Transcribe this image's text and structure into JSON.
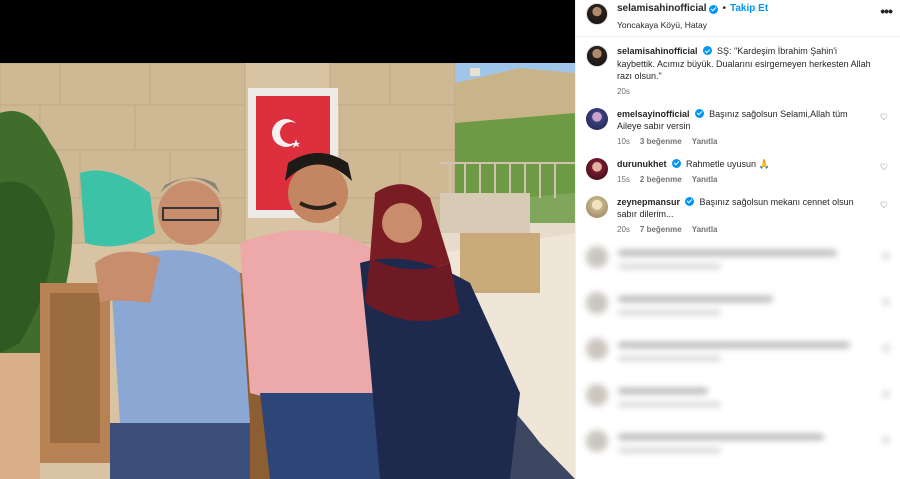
{
  "post": {
    "username": "selamisahinofficial",
    "dot": "•",
    "follow_label": "Takip Et",
    "location": "Yoncakaya Köyü, Hatay",
    "more_label": "•••"
  },
  "caption": {
    "username": "selamisahinofficial",
    "text": "SŞ: \"Kardeşim İbrahim Şahin'i kaybettik. Acımız büyük. Dualarını esirgemeyen herkesten Allah razı olsun.\"",
    "time": "20s"
  },
  "comments": [
    {
      "username": "emelsayinofficial",
      "text": "Başınız sağolsun Selami,Allah tüm Aileye sabır versin",
      "time": "10s",
      "likes": "3 beğenme",
      "reply": "Yanıtla",
      "avatar_color": "#3b3f7e"
    },
    {
      "username": "durunukhet",
      "text": "Rahmetle uyusun 🙏",
      "time": "15s",
      "likes": "2 beğenme",
      "reply": "Yanıtla",
      "avatar_color": "#7a1a2f"
    },
    {
      "username": "zeynepmansur",
      "text": "Başınız sağolsun mekanı cennet olsun sabır dilerim...",
      "time": "20s",
      "likes": "7 beğenme",
      "reply": "Yanıtla",
      "avatar_color": "#c8b58a"
    }
  ],
  "icons": {
    "heart": "heart-icon",
    "verified": "verified-badge-icon",
    "more": "more-options-icon"
  },
  "colors": {
    "accent": "#0095f6",
    "text": "#262626",
    "muted": "#737373",
    "media_bg": "#000000"
  }
}
